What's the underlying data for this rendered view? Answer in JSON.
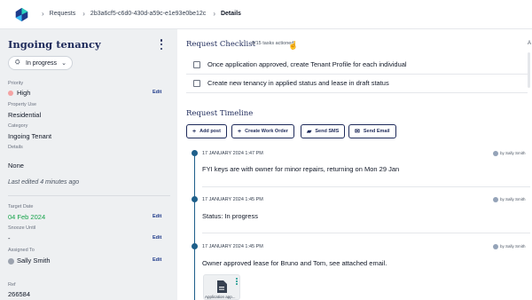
{
  "breadcrumb": {
    "items": [
      "Requests",
      "2b3a6cf5-c6d0-430d-a59c-e1e93e0be12c",
      "Details"
    ]
  },
  "sidebar": {
    "title": "Ingoing tenancy",
    "status": "In progress",
    "priority_label": "Priority",
    "priority_value": "High",
    "edit_label": "Edit",
    "property_use_label": "Property Use",
    "property_use_value": "Residential",
    "category_label": "Category",
    "category_value": "Ingoing Tenant",
    "details_label": "Details",
    "details_value": "None",
    "last_edited": "Last edited 4 minutes ago",
    "target_date_label": "Target Date",
    "target_date_value": "04 Feb 2024",
    "snooze_label": "Snooze Until",
    "snooze_value": "-",
    "assigned_label": "Assigned To",
    "assigned_value": "Sally Smith",
    "ref_label": "Ref",
    "ref_value": "266584"
  },
  "checklist": {
    "title": "Request Checklist",
    "badge": "0/15 tasks actioned",
    "edge_letter": "A",
    "items": [
      "Once application approved, create Tenant Profile for each individual",
      "Create new tenancy in applied status and lease in draft status"
    ]
  },
  "timeline": {
    "title": "Request Timeline",
    "buttons": {
      "add_post": "Add post",
      "create_work_order": "Create Work Order",
      "send_sms": "Send SMS",
      "send_email": "Send Email"
    },
    "entries": [
      {
        "date": "17 JANUARY 2024 1:47 PM",
        "by": "by Sally Smith",
        "text": "FYI keys are with owner for minor repairs, returning on Mon 29 Jan"
      },
      {
        "date": "17 JANUARY 2024 1:45 PM",
        "by": "by Sally Smith",
        "text": "Status: In progress"
      },
      {
        "date": "17 JANUARY 2024 1:45 PM",
        "by": "by Sally Smith",
        "text": "Owner approved lease for Bruno and Tom, see attached email."
      }
    ],
    "attachment_label": "Application app..."
  },
  "colors": {
    "brand": "#1e2a5a",
    "timeline": "#1e5f8a",
    "sidebar_bg": "#eef0f2",
    "target_date": "#16a34a",
    "priority_dot": "#f4a3a3"
  },
  "icons": {
    "logo": "app-logo",
    "status": "assignment-icon",
    "add": "plus-icon",
    "sms": "chat-icon",
    "email": "envelope-icon",
    "file": "document-icon"
  }
}
